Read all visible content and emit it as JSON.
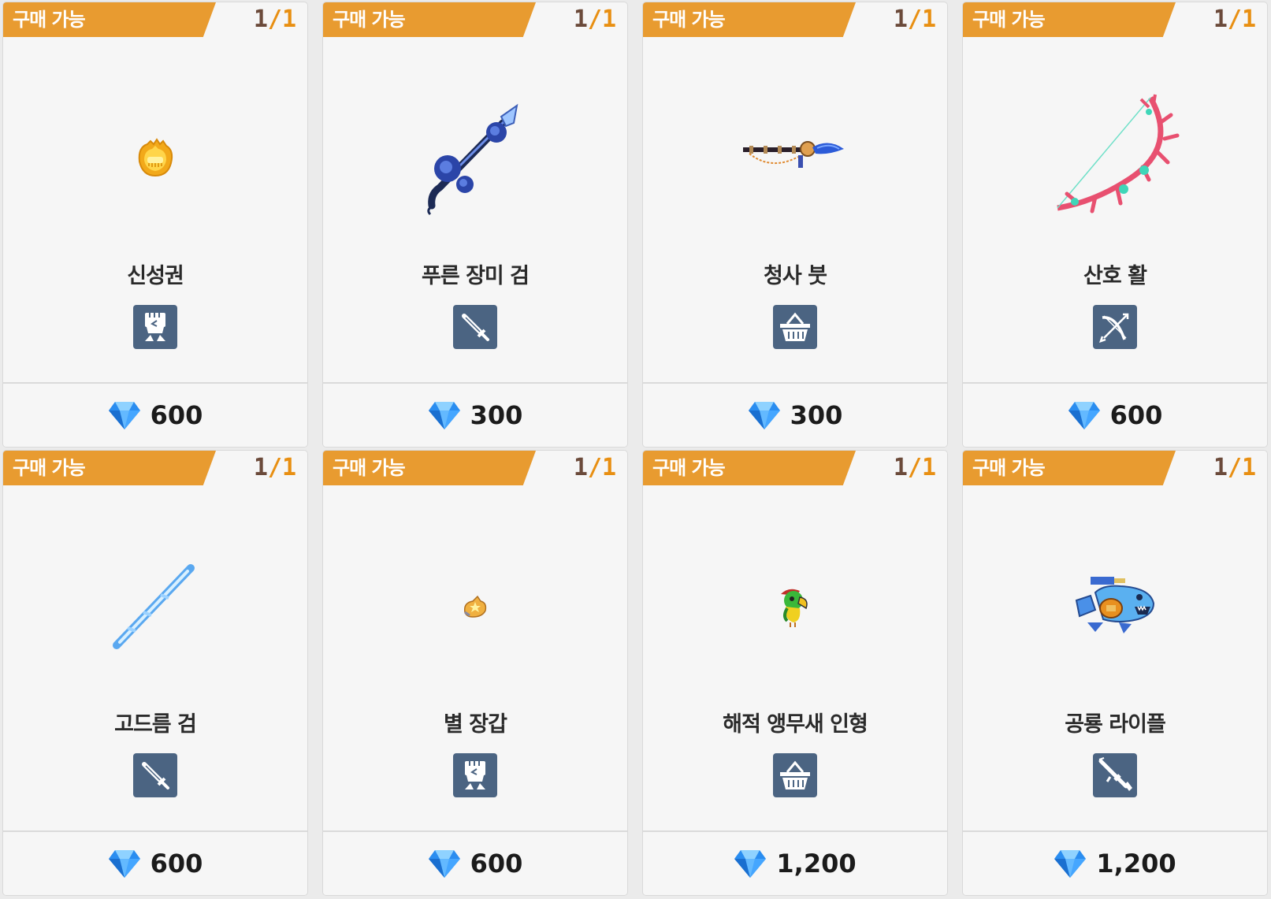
{
  "shop": {
    "items": [
      {
        "status": "구매 가능",
        "stock_current": "1",
        "stock_sep": "/",
        "stock_max": "1",
        "name": "신성권",
        "category": "fist",
        "image": "holy-fist",
        "price": "600"
      },
      {
        "status": "구매 가능",
        "stock_current": "1",
        "stock_sep": "/",
        "stock_max": "1",
        "name": "푸른 장미 검",
        "category": "sword",
        "image": "blue-rose-sword",
        "price": "300"
      },
      {
        "status": "구매 가능",
        "stock_current": "1",
        "stock_sep": "/",
        "stock_max": "1",
        "name": "청사 붓",
        "category": "basket",
        "image": "blue-brush",
        "price": "300"
      },
      {
        "status": "구매 가능",
        "stock_current": "1",
        "stock_sep": "/",
        "stock_max": "1",
        "name": "산호 활",
        "category": "bow",
        "image": "coral-bow",
        "price": "600"
      },
      {
        "status": "구매 가능",
        "stock_current": "1",
        "stock_sep": "/",
        "stock_max": "1",
        "name": "고드름 검",
        "category": "sword",
        "image": "icicle-sword",
        "price": "600"
      },
      {
        "status": "구매 가능",
        "stock_current": "1",
        "stock_sep": "/",
        "stock_max": "1",
        "name": "별 장갑",
        "category": "fist",
        "image": "star-glove",
        "price": "600"
      },
      {
        "status": "구매 가능",
        "stock_current": "1",
        "stock_sep": "/",
        "stock_max": "1",
        "name": "해적 앵무새 인형",
        "category": "basket",
        "image": "pirate-parrot-doll",
        "price": "1,200"
      },
      {
        "status": "구매 가능",
        "stock_current": "1",
        "stock_sep": "/",
        "stock_max": "1",
        "name": "공룡 라이플",
        "category": "rifle",
        "image": "dino-rifle",
        "price": "1,200"
      }
    ]
  },
  "colors": {
    "status_tag": "#e89b30",
    "stock_current": "#6b4a3a",
    "stock_max": "#e88f12",
    "category_bg": "#4b6482",
    "gem": "#2a8df0"
  },
  "icons": {
    "currency": "diamond-gem-icon",
    "fist": "fist-icon",
    "sword": "sword-icon",
    "basket": "basket-icon",
    "bow": "bow-icon",
    "rifle": "rifle-icon"
  }
}
